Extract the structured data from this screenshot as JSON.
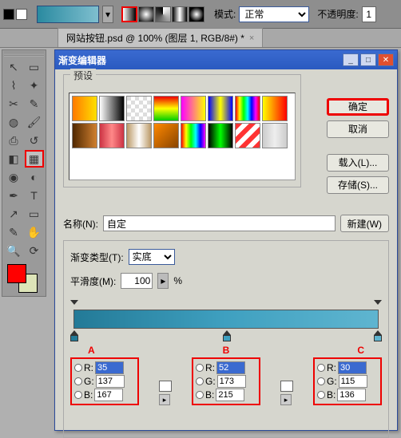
{
  "toolbar": {
    "mode_label": "模式:",
    "mode_value": "正常",
    "opacity_label": "不透明度:",
    "opacity_value": "1"
  },
  "tab": {
    "title": "网站按钮.psd @ 100% (图层 1, RGB/8#) *",
    "close": "×"
  },
  "dialog": {
    "title": "渐变编辑器",
    "presets_label": "预设",
    "ok": "确定",
    "cancel": "取消",
    "load": "载入(L)...",
    "save": "存储(S)...",
    "name_label": "名称(N):",
    "name_value": "自定",
    "new_btn": "新建(W)",
    "type_label": "渐变类型(T):",
    "type_value": "实底",
    "smooth_label": "平滑度(M):",
    "smooth_value": "100",
    "smooth_unit": "%",
    "markers": {
      "a": "A",
      "b": "B",
      "c": "C"
    },
    "rgb": {
      "r_label": "R:",
      "g_label": "G:",
      "b_label": "B:",
      "a": {
        "r": "35",
        "g": "137",
        "b": "167"
      },
      "b": {
        "r": "52",
        "g": "173",
        "b": "215"
      },
      "c": {
        "r": "30",
        "g": "115",
        "b": "136"
      }
    }
  },
  "presets": [
    "linear-gradient(to right,#ff7a00,#ffe000)",
    "linear-gradient(to right,#fff,#000)",
    "repeating-conic-gradient(#fff 0 25%,#ddd 0 50%) 50%/10px 10px",
    "linear-gradient(#e00,#ff0,#0c0)",
    "linear-gradient(to right,#f0f,#ff0)",
    "linear-gradient(to right,#00f,#ff0,#00f)",
    "linear-gradient(to right,#f00,#ff0,#0f0,#0ff,#00f,#f0f,#f00)",
    "linear-gradient(to right,#ff0,#f00)",
    "linear-gradient(to right,#502800,#d08030)",
    "linear-gradient(to right,#c34,#f88,#c34)",
    "linear-gradient(to right,#b96,#fff,#b96)",
    "linear-gradient(135deg,#f80,#840)",
    "linear-gradient(to right,#f00,#ff0,#0f0,#0ff,#00f,#f0f)",
    "linear-gradient(to right,#000,#0f0,#000)",
    "repeating-linear-gradient(135deg,#f33 0 6px,#fff 6px 12px)",
    "linear-gradient(to right,#ccc,#eee,#ccc)"
  ],
  "gradient_colors": {
    "start": "#237a97",
    "mid": "#3fa0c0",
    "end": "#5fb5d0"
  }
}
